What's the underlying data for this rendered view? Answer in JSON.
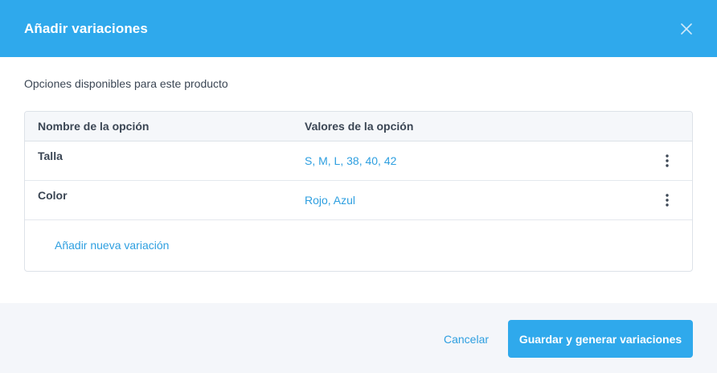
{
  "dialog": {
    "title": "Añadir variaciones",
    "close_icon": "close-icon",
    "subtitle": "Opciones disponibles para este producto"
  },
  "table": {
    "headers": [
      "Nombre de la opción",
      "Valores de la opción"
    ],
    "rows": [
      {
        "name": "Talla",
        "values": "S, M, L, 38, 40, 42",
        "menu_icon": "kebab-menu-icon"
      },
      {
        "name": "Color",
        "values": "Rojo, Azul",
        "menu_icon": "kebab-menu-icon"
      }
    ],
    "add_label": "Añadir nueva variación"
  },
  "footer": {
    "cancel_label": "Cancelar",
    "save_label": "Guardar y generar variaciones"
  },
  "colors": {
    "accent": "#2fa9ec",
    "link": "#2e9fe0",
    "text": "#3b4654",
    "footer_bg": "#f4f6fa"
  }
}
